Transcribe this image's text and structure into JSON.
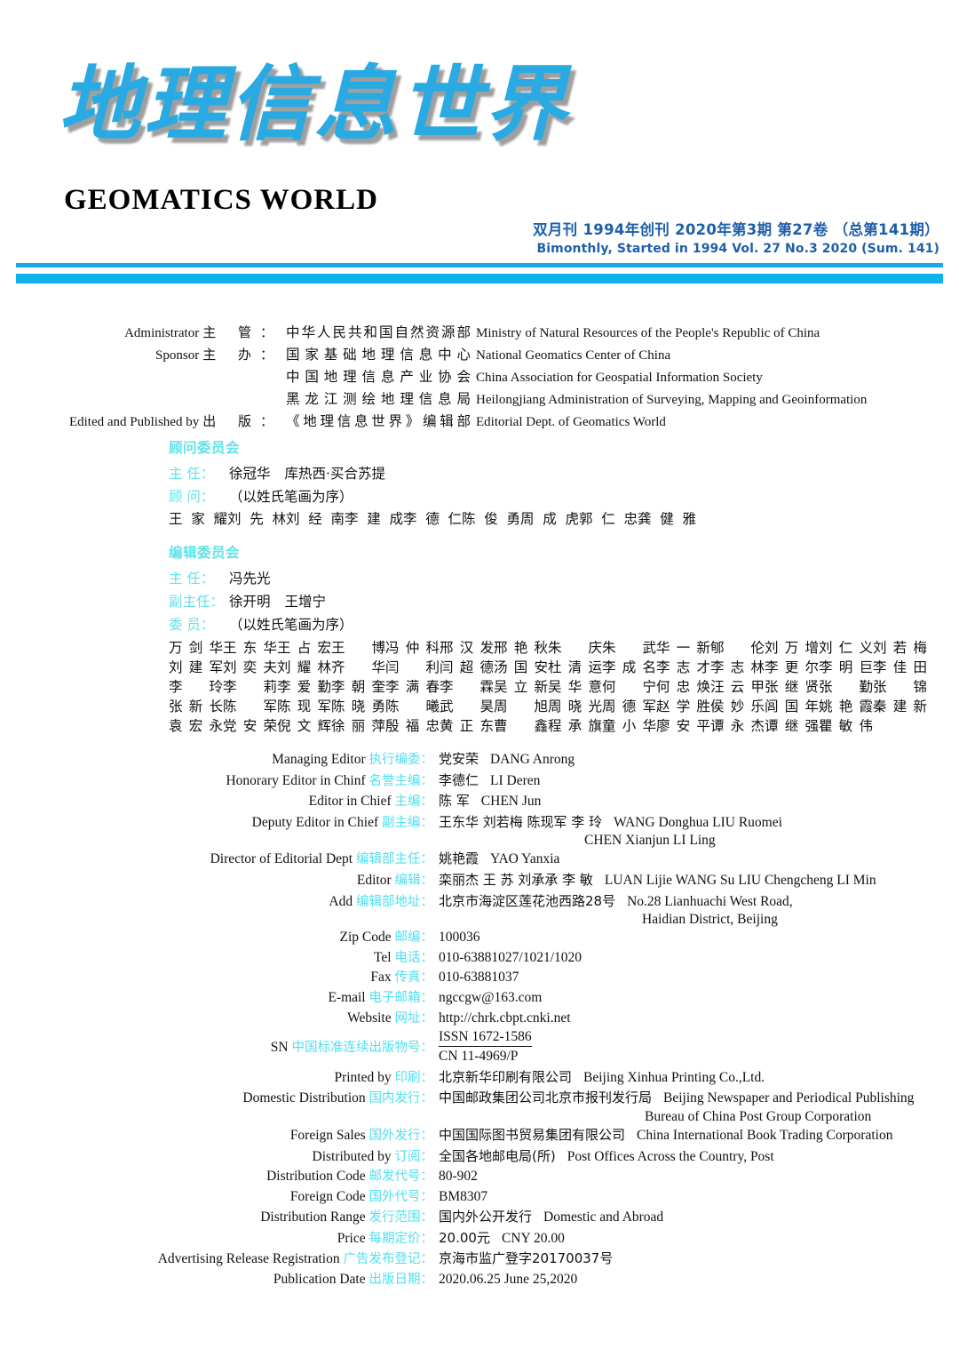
{
  "masthead": {
    "title_cn": "地理信息世界",
    "title_en": "GEOMATICS  WORLD",
    "issue_cn": "双月刊  1994年创刊  2020年第3期  第27卷 （总第141期）",
    "issue_en": "Bimonthly, Started in 1994 Vol. 27 No.3 2020 (Sum. 141)",
    "accent_color": "#29aae2",
    "rule_color": "#0fb1ec",
    "issue_color": "#1f5fa8"
  },
  "organization": {
    "rows": [
      {
        "label_en": "Administrator",
        "label_cn": "主 管：",
        "cn": "中华人民共和国自然资源部",
        "en": "Ministry of Natural Resources of the People's Republic of China"
      },
      {
        "label_en": "Sponsor",
        "label_cn": "主 办：",
        "cn": "国家基础地理信息中心",
        "en": "National Geomatics Center of China"
      },
      {
        "label_en": "",
        "label_cn": "",
        "cn": "中国地理信息产业协会",
        "en": "China Association for Geospatial Information Society"
      },
      {
        "label_en": "",
        "label_cn": "",
        "cn": "黑龙江测绘地理信息局",
        "en": "Heilongjiang Administration of Surveying, Mapping and Geoinformation"
      },
      {
        "label_en": "Edited and Published by",
        "label_cn": "出 版：",
        "cn": "《地理信息世界》编辑部",
        "en": "Editorial Dept. of Geomatics World"
      }
    ]
  },
  "advisory_committee": {
    "heading": "顾问委员会",
    "chair_role": "主  任：",
    "chair_value": "徐冠华",
    "chair_value2": "库热西·买合苏提",
    "advisor_role": "顾  问：",
    "advisor_note": "（以姓氏笔画为序）",
    "advisors": [
      "王家耀",
      "刘先林",
      "刘经南",
      "李建成",
      "李德仁",
      "陈俊勇",
      "周成虎",
      "郭仁忠",
      "龚健雅"
    ]
  },
  "editorial_committee": {
    "heading": "编辑委员会",
    "chair_role": "主  任：",
    "chair_value": "冯先光",
    "vice_role": "副主任：",
    "vice_value": "徐开明",
    "vice_value2": "王增宁",
    "member_role": "委  员：",
    "member_note": "（以姓氏笔画为序）",
    "members_rows": [
      [
        "万剑华",
        "王东华",
        "王占宏",
        "王  博",
        "冯仲科",
        "邢汉发",
        "邢艳秋",
        "朱  庆",
        "朱  武",
        "华一新",
        "郇  伦",
        "刘万增",
        "刘仁义",
        "刘若梅"
      ],
      [
        "刘建军",
        "刘奕夫",
        "刘耀林",
        "齐  华",
        "闫  利",
        "闫超德",
        "汤国安",
        "杜清运",
        "李成名",
        "李志才",
        "李志林",
        "李更尔",
        "李明巨",
        "李佳田"
      ],
      [
        "李  玲",
        "李  莉",
        "李爱勤",
        "李朝奎",
        "李满春",
        "李  霖",
        "吴立新",
        "吴华意",
        "何  宁",
        "何忠焕",
        "汪云甲",
        "张继贤",
        "张  勤",
        "张  锦"
      ],
      [
        "张新长",
        "陈  军",
        "陈现军",
        "陈晓勇",
        "陈  曦",
        "武  昊",
        "周  旭",
        "周晓光",
        "周德军",
        "赵学胜",
        "侯妙乐",
        "闾国年",
        "姚艳霞",
        "秦建新"
      ],
      [
        "袁宏永",
        "党安荣",
        "倪文辉",
        "徐丽萍",
        "殷福忠",
        "黄正东",
        "曹  鑫",
        "程承旗",
        "童小华",
        "廖安平",
        "谭永杰",
        "谭继强",
        "瞿敏伟"
      ]
    ]
  },
  "imprint": {
    "rows": [
      {
        "label_en": "Managing Editor",
        "label_cn": "执行编委：",
        "value_cn": "党安荣",
        "value_en": "DANG Anrong"
      },
      {
        "label_en": "Honorary Editor in Chinf",
        "label_cn": "名誉主编：",
        "value_cn": "李德仁",
        "value_en": "LI Deren"
      },
      {
        "label_en": "Editor in Chief",
        "label_cn": "主编：",
        "value_cn": "陈  军",
        "value_en": "CHEN Jun"
      },
      {
        "label_en": "Deputy Editor in Chief",
        "label_cn": "副主编：",
        "value_cn": "王东华  刘若梅  陈现军  李  玲",
        "value_en": "WANG Donghua  LIU Ruomei",
        "cont": "CHEN Xianjun  LI Ling",
        "cont_class": "c1"
      },
      {
        "label_en": "Director of Editorial Dept",
        "label_cn": "编辑部主任：",
        "value_cn": "姚艳霞",
        "value_en": "YAO Yanxia"
      },
      {
        "label_en": "Editor",
        "label_cn": "编辑：",
        "value_cn": "栾丽杰  王  苏  刘承承  李  敏",
        "value_en": "LUAN Lijie WANG Su LIU Chengcheng  LI Min"
      },
      {
        "label_en": "Add",
        "label_cn": "编辑部地址：",
        "value_cn": "北京市海淀区莲花池西路28号",
        "value_en": "No.28 Lianhuachi West Road,",
        "cont": "Haidian District, Beijing",
        "cont_class": "c2"
      },
      {
        "label_en": "Zip Code",
        "label_cn": "邮编：",
        "value_cn": "",
        "value_en": "100036"
      },
      {
        "label_en": "Tel",
        "label_cn": "电话：",
        "value_cn": "",
        "value_en": "010-63881027/1021/1020"
      },
      {
        "label_en": "Fax",
        "label_cn": "传真：",
        "value_cn": "",
        "value_en": "010-63881037"
      },
      {
        "label_en": "E-mail",
        "label_cn": "电子邮箱：",
        "value_cn": "",
        "value_en": "ngccgw@163.com"
      },
      {
        "label_en": "Website",
        "label_cn": "网址：",
        "value_cn": "",
        "value_en": "http://chrk.cbpt.cnki.net"
      }
    ],
    "sn": {
      "label_en": "SN",
      "label_cn": "中国标准连续出版物号：",
      "issn": "ISSN 1672-1586",
      "cn_code": "CN 11-4969/P"
    },
    "rows2": [
      {
        "label_en": "Printed by",
        "label_cn": "印刷：",
        "value_cn": "北京新华印刷有限公司",
        "value_en": "Beijing Xinhua Printing Co.,Ltd."
      },
      {
        "label_en": "Domestic Distribution",
        "label_cn": "国内发行：",
        "value_cn": "中国邮政集团公司北京市报刊发行局",
        "value_en": "Beijing Newspaper and Periodical Publishing",
        "cont": "Bureau of China Post Group Corporation",
        "cont_class": "c3"
      },
      {
        "label_en": "Foreign Sales",
        "label_cn": "国外发行：",
        "value_cn": "中国国际图书贸易集团有限公司",
        "value_en": "China International Book Trading Corporation"
      },
      {
        "label_en": "Distributed by",
        "label_cn": "订阅：",
        "value_cn": "全国各地邮电局(所)",
        "value_en": "Post Offices Across the Country, Post"
      },
      {
        "label_en": "Distribution Code",
        "label_cn": "邮发代号：",
        "value_cn": "",
        "value_en": "80-902"
      },
      {
        "label_en": "Foreign Code",
        "label_cn": "国外代号：",
        "value_cn": "",
        "value_en": "BM8307"
      },
      {
        "label_en": "Distribution Range",
        "label_cn": "发行范围：",
        "value_cn": "国内外公开发行",
        "value_en": "Domestic and Abroad"
      },
      {
        "label_en": "Price",
        "label_cn": "每期定价：",
        "value_cn": "20.00元",
        "value_en": "CNY 20.00"
      },
      {
        "label_en": "Advertising Release Registration",
        "label_cn": "广告发布登记：",
        "value_cn": "京海市监广登字20170037号",
        "value_en": ""
      },
      {
        "label_en": "Publication Date",
        "label_cn": "出版日期：",
        "value_cn": "",
        "value_en": "2020.06.25  June 25,2020"
      }
    ]
  }
}
